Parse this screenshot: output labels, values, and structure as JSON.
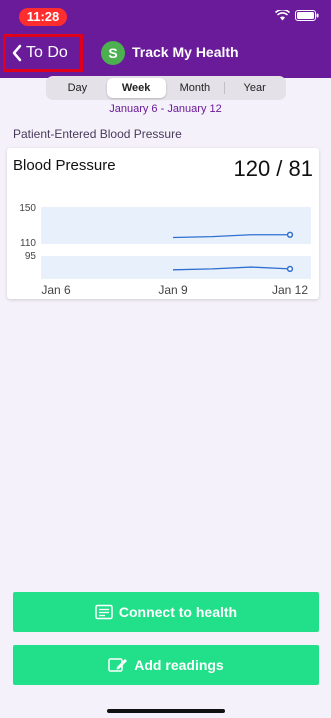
{
  "status": {
    "time": "11:28"
  },
  "header": {
    "back_label": "To Do",
    "avatar_letter": "S",
    "title": "Track My Health"
  },
  "range_tabs": [
    {
      "label": "Day",
      "active": false
    },
    {
      "label": "Week",
      "active": true
    },
    {
      "label": "Month",
      "active": false
    },
    {
      "label": "Year",
      "active": false
    }
  ],
  "date_range": "January 6 - January 12",
  "section_label": "Patient-Entered Blood Pressure",
  "card": {
    "title": "Blood Pressure",
    "value": "120 / 81"
  },
  "chart_data": {
    "type": "line",
    "x_tick_labels": [
      "Jan 6",
      "Jan 9",
      "Jan 12"
    ],
    "y_tick_labels": [
      "150",
      "110",
      "95"
    ],
    "series": [
      {
        "values": [
          {
            "x": "Jan 9",
            "y": 117
          },
          {
            "x": "Jan 10",
            "y": 118
          },
          {
            "x": "Jan 11",
            "y": 120
          },
          {
            "x": "Jan 12",
            "y": 120
          }
        ]
      },
      {
        "values": [
          {
            "x": "Jan 9",
            "y": 80
          },
          {
            "x": "Jan 10",
            "y": 81
          },
          {
            "x": "Jan 11",
            "y": 83
          },
          {
            "x": "Jan 12",
            "y": 81
          }
        ]
      }
    ],
    "line_color": "#2f6fd1",
    "band_color": "#e8f1fb"
  },
  "buttons": {
    "connect_label": "Connect to health",
    "add_label": "Add readings"
  },
  "colors": {
    "header": "#6a1b9a",
    "accent_green": "#22e08a",
    "avatar": "#4caf50",
    "highlight": "#e0001b"
  }
}
